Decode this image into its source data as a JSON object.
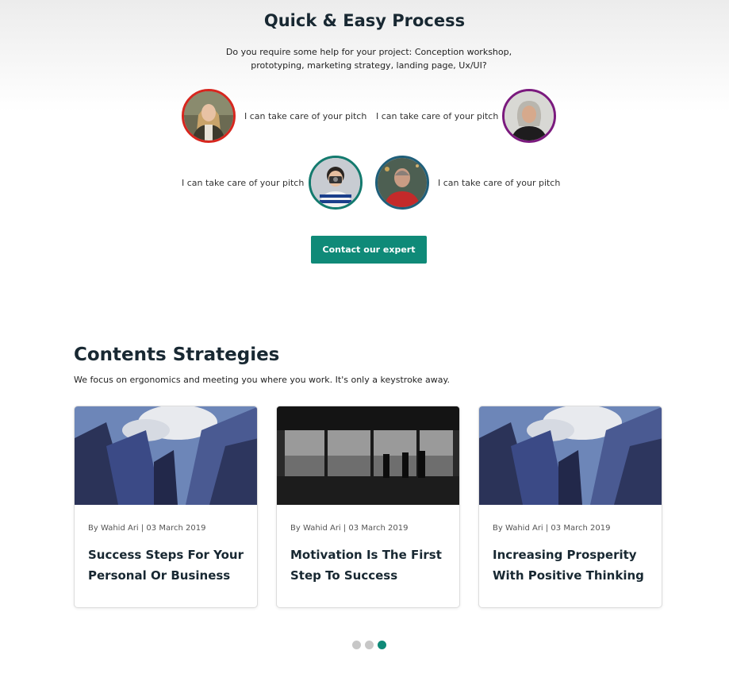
{
  "process": {
    "title": "Quick & Easy Process",
    "description": "Do you require some help for your project: Conception workshop, prototyping, marketing strategy, landing page, Ux/UI?",
    "experts": [
      {
        "pitch": "I can take care of your pitch",
        "border_color": "#d7261e"
      },
      {
        "pitch": "I can take care of your pitch",
        "border_color": "#7b1a7e"
      },
      {
        "pitch": "I can take care of your pitch",
        "border_color": "#137a6e"
      },
      {
        "pitch": "I can take care of your pitch",
        "border_color": "#1f5f7a"
      }
    ],
    "contact_label": "Contact our expert"
  },
  "contents": {
    "title": "Contents Strategies",
    "subtitle": "We focus on ergonomics and meeting you where you work. It's only a keystroke away.",
    "cards": [
      {
        "meta": "By Wahid Ari | 03 March 2019",
        "title": "Success Steps For Your Personal Or Business"
      },
      {
        "meta": "By Wahid Ari | 03 March 2019",
        "title": "Motivation Is The First Step To Success"
      },
      {
        "meta": "By Wahid Ari | 03 March 2019",
        "title": "Increasing Prosperity With Positive Thinking"
      }
    ]
  },
  "carousel": {
    "pages": 3,
    "active_page": 3
  },
  "colors": {
    "accent": "#0f8a78",
    "heading": "#182832"
  }
}
